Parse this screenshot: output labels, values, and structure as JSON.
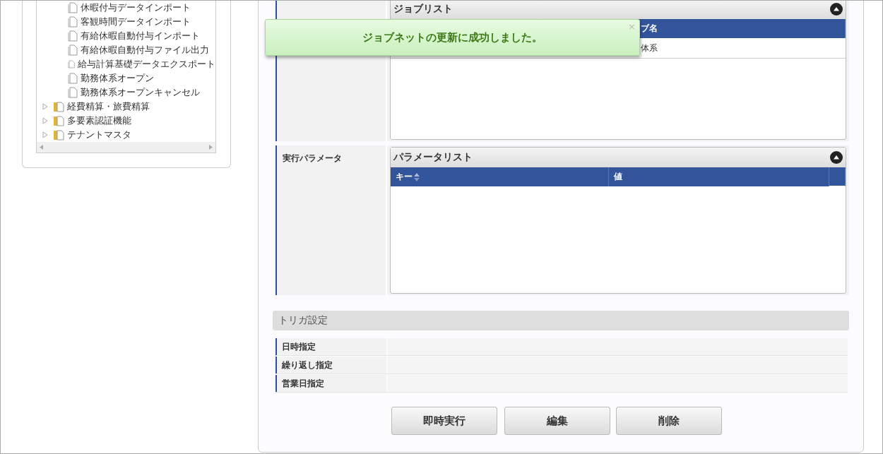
{
  "tree": {
    "child_items": [
      {
        "label": "休暇付与データインポート"
      },
      {
        "label": "客観時間データインポート"
      },
      {
        "label": "有給休暇自動付与インポート"
      },
      {
        "label": "有給休暇自動付与ファイル出力"
      },
      {
        "label": "給与計算基礎データエクスポート"
      },
      {
        "label": "勤務体系オープン"
      },
      {
        "label": "勤務体系オープンキャンセル"
      }
    ],
    "folders": [
      {
        "label": "経費精算・旅費精算",
        "expanded": false
      },
      {
        "label": "多要素認証機能",
        "expanded": false
      },
      {
        "label": "テナントマスタ",
        "expanded": false
      }
    ]
  },
  "job_section": {
    "panel_title": "ジョブリスト",
    "column_2": "ブ名",
    "row_cell": "体系"
  },
  "param_section": {
    "label": "実行パラメータ",
    "panel_title": "パラメータリスト",
    "columns": [
      "キー",
      "値"
    ]
  },
  "trigger": {
    "title": "トリガ設定",
    "rows": [
      "日時指定",
      "繰り返し指定",
      "営業日指定"
    ]
  },
  "buttons": [
    "即時実行",
    "編集",
    "削除"
  ],
  "toast": {
    "message": "ジョブネットの更新に成功しました。",
    "close": "×"
  }
}
